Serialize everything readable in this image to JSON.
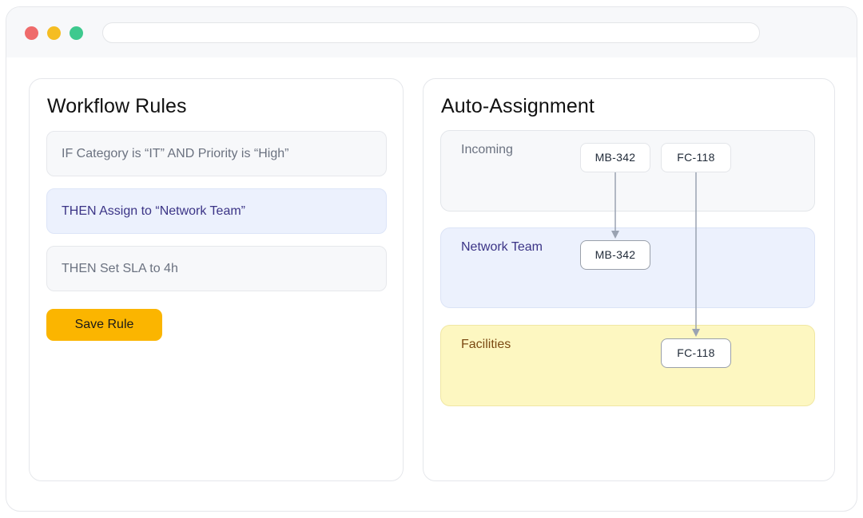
{
  "window": {
    "controls": [
      "close",
      "minimize",
      "maximize"
    ],
    "address": ""
  },
  "workflow": {
    "title": "Workflow Rules",
    "rules": [
      "IF Category is “IT” AND Priority is “High”",
      "THEN Assign to “Network Team”",
      "THEN Set SLA to 4h"
    ],
    "save_label": "Save Rule"
  },
  "assignment": {
    "title": "Auto-Assignment",
    "lanes": [
      {
        "label": "Incoming",
        "tickets": [
          "MB-342",
          "FC-118"
        ]
      },
      {
        "label": "Network Team",
        "tickets": [
          "MB-342"
        ]
      },
      {
        "label": "Facilities",
        "tickets": [
          "FC-118"
        ]
      }
    ]
  },
  "colors": {
    "accent_button": "#fbb500",
    "network_lane": "#ecf1fd",
    "facilities_lane": "#fdf7c1",
    "arrow": "#9aa3b2"
  }
}
